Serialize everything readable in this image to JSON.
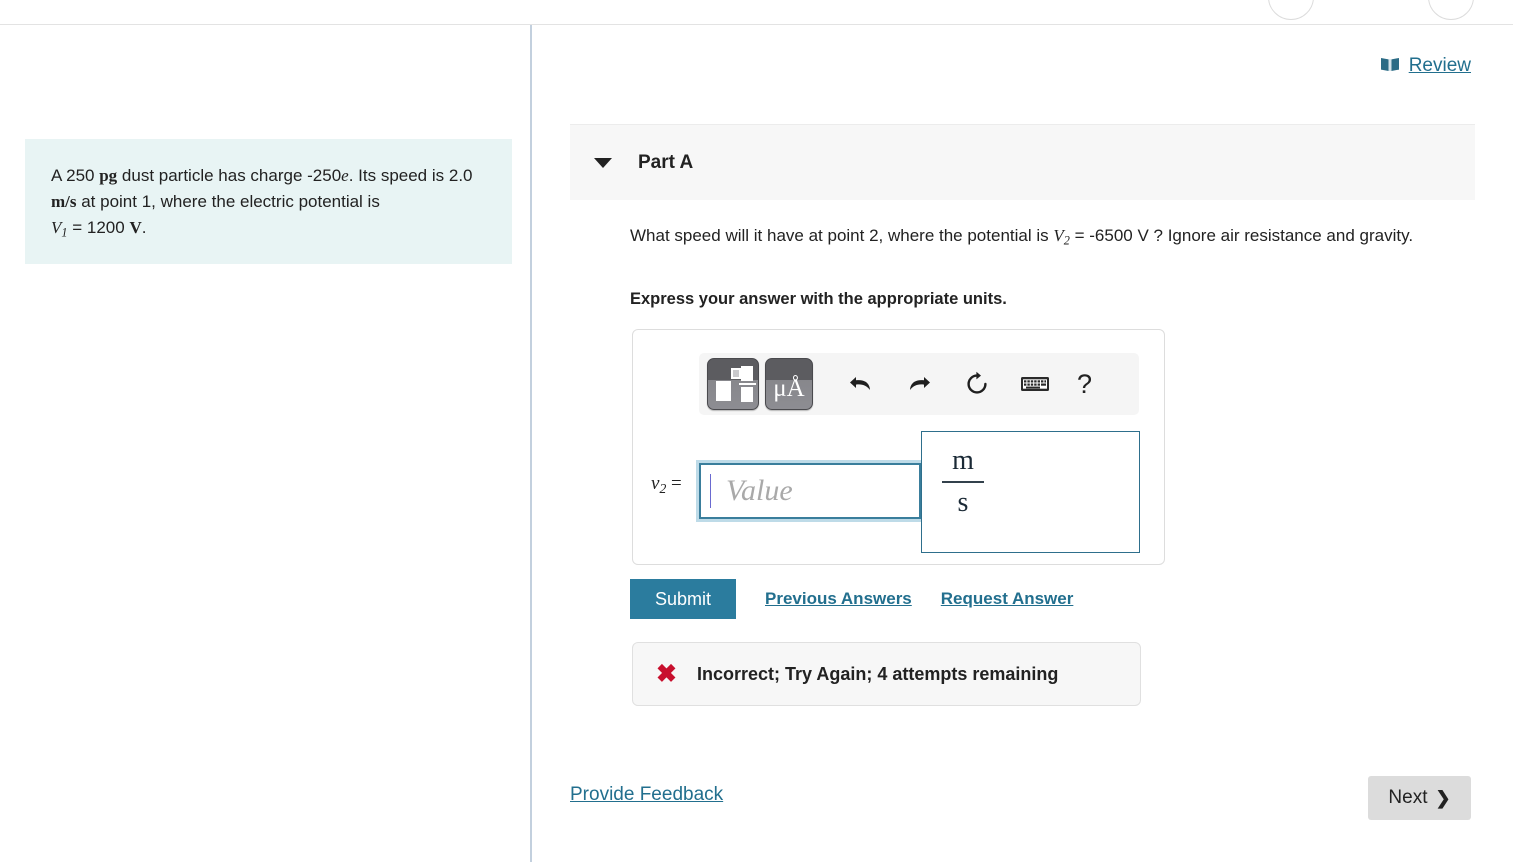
{
  "review": {
    "label": "Review",
    "icon": "book-icon"
  },
  "part": {
    "title": "Part A",
    "expanded_icon": "caret-down-icon"
  },
  "question": {
    "text_before_var": "What speed will it have at point 2, where the potential is ",
    "variable": "V",
    "variable_sub": "2",
    "text_after_var": " = -6500 V ? Ignore air resistance and gravity.",
    "instruction": "Express your answer with the appropriate units."
  },
  "problem": {
    "line1_a": "A 250 ",
    "line1_pg": "pg",
    "line1_b": " dust particle has charge -250",
    "line1_e": "e",
    "line1_c": ". Its speed is 2.0 ",
    "line1_ms": "m/s",
    "line1_d": " at point 1, where the electric potential is ",
    "line2_V": "V",
    "line2_sub": "1",
    "line2_val": " = 1200 ",
    "line2_unit": "V",
    "line2_end": "."
  },
  "toolbar": {
    "template_button": "math-template",
    "units_button": "μÅ",
    "undo_button": "undo",
    "redo_button": "redo",
    "reset_button": "reset",
    "keyboard_button": "keyboard",
    "help_button": "?"
  },
  "answer": {
    "variable": "v",
    "variable_sub": "2",
    "equals": "=",
    "placeholder": "Value",
    "units_numerator": "m",
    "units_denominator": "s"
  },
  "actions": {
    "submit": "Submit",
    "previous_answers": "Previous Answers",
    "request_answer": "Request Answer"
  },
  "feedback": {
    "icon": "x-mark-icon",
    "message": "Incorrect; Try Again; 4 attempts remaining"
  },
  "footer": {
    "provide_feedback": "Provide Feedback",
    "next": "Next",
    "next_chevron": "❯"
  },
  "colors": {
    "accent": "#226f8e",
    "submit": "#2b7c9e",
    "error": "#c8102e",
    "problem_bg": "#e8f4f4",
    "divider": "#c3d0de"
  }
}
